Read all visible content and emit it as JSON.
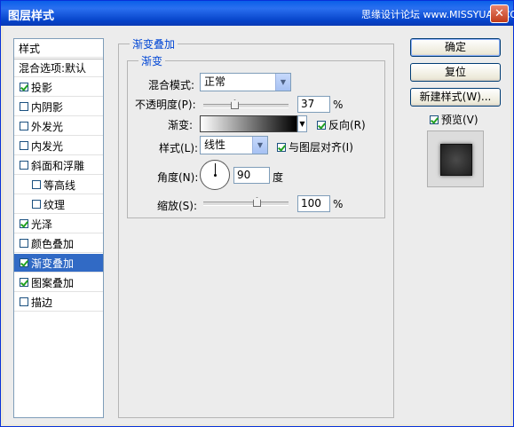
{
  "window": {
    "title": "图层样式",
    "watermark": "思缘设计论坛 www.MISSYUAN.COM"
  },
  "styles_list": {
    "header": "样式",
    "blend_default": "混合选项:默认",
    "items": [
      {
        "label": "投影",
        "checked": true,
        "indent": false,
        "selected": false
      },
      {
        "label": "内阴影",
        "checked": false,
        "indent": false,
        "selected": false
      },
      {
        "label": "外发光",
        "checked": false,
        "indent": false,
        "selected": false
      },
      {
        "label": "内发光",
        "checked": false,
        "indent": false,
        "selected": false
      },
      {
        "label": "斜面和浮雕",
        "checked": false,
        "indent": false,
        "selected": false
      },
      {
        "label": "等高线",
        "checked": false,
        "indent": true,
        "selected": false
      },
      {
        "label": "纹理",
        "checked": false,
        "indent": true,
        "selected": false
      },
      {
        "label": "光泽",
        "checked": true,
        "indent": false,
        "selected": false
      },
      {
        "label": "颜色叠加",
        "checked": false,
        "indent": false,
        "selected": false
      },
      {
        "label": "渐变叠加",
        "checked": true,
        "indent": false,
        "selected": true
      },
      {
        "label": "图案叠加",
        "checked": true,
        "indent": false,
        "selected": false
      },
      {
        "label": "描边",
        "checked": false,
        "indent": false,
        "selected": false
      }
    ]
  },
  "panel": {
    "outer_title": "渐变叠加",
    "inner_title": "渐变",
    "blend_mode_label": "混合模式:",
    "blend_mode_value": "正常",
    "opacity_label": "不透明度(P):",
    "opacity_value": "37",
    "opacity_unit": "%",
    "gradient_label": "渐变:",
    "reverse_label": "反向(R)",
    "reverse_checked": true,
    "style_label": "样式(L):",
    "style_value": "线性",
    "align_label": "与图层对齐(I)",
    "align_checked": true,
    "angle_label": "角度(N):",
    "angle_value": "90",
    "angle_unit": "度",
    "scale_label": "缩放(S):",
    "scale_value": "100",
    "scale_unit": "%"
  },
  "buttons": {
    "ok": "确定",
    "reset": "复位",
    "new_style": "新建样式(W)...",
    "preview_label": "预览(V)",
    "preview_checked": true
  }
}
